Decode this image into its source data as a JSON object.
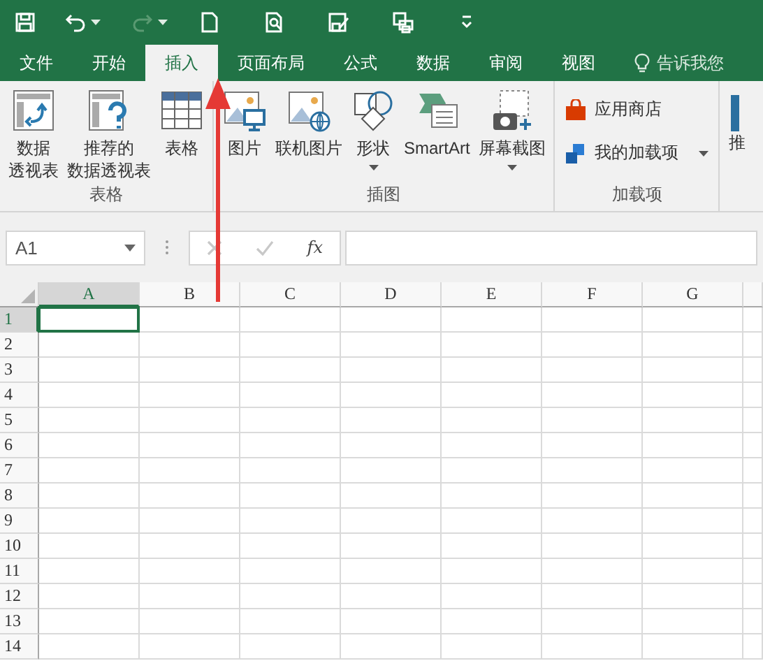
{
  "quick_access": [
    {
      "kind": "save",
      "disabled": false
    },
    {
      "kind": "undo",
      "disabled": false,
      "dropdown": true
    },
    {
      "kind": "redo",
      "disabled": true,
      "dropdown": true
    },
    {
      "kind": "new",
      "disabled": false
    },
    {
      "kind": "preview",
      "disabled": false
    },
    {
      "kind": "save-edit",
      "disabled": false
    },
    {
      "kind": "print",
      "disabled": false
    },
    {
      "kind": "customize",
      "disabled": false
    }
  ],
  "tabs": [
    {
      "label": "文件",
      "selected": false
    },
    {
      "label": "开始",
      "selected": false
    },
    {
      "label": "插入",
      "selected": true
    },
    {
      "label": "页面布局",
      "selected": false
    },
    {
      "label": "公式",
      "selected": false
    },
    {
      "label": "数据",
      "selected": false
    },
    {
      "label": "审阅",
      "selected": false
    },
    {
      "label": "视图",
      "selected": false
    }
  ],
  "tell_me": {
    "placeholder": "告诉我您"
  },
  "ribbon": {
    "groups": [
      {
        "label": "表格",
        "buttons": [
          {
            "kind": "pivot",
            "lines": [
              "数据",
              "透视表"
            ]
          },
          {
            "kind": "recommended-pivot",
            "lines": [
              "推荐的",
              "数据透视表"
            ]
          },
          {
            "kind": "table",
            "lines": [
              "表格"
            ]
          }
        ]
      },
      {
        "label": "插图",
        "buttons": [
          {
            "kind": "picture",
            "lines": [
              "图片"
            ]
          },
          {
            "kind": "online-picture",
            "lines": [
              "联机图片"
            ]
          },
          {
            "kind": "shapes",
            "lines": [
              "形状"
            ],
            "dropdown": true
          },
          {
            "kind": "smartart",
            "lines": [
              "SmartArt"
            ]
          },
          {
            "kind": "screenshot",
            "lines": [
              "屏幕截图"
            ],
            "dropdown": true
          }
        ]
      },
      {
        "label": "加载项",
        "small_buttons": [
          {
            "kind": "store",
            "label": "应用商店"
          },
          {
            "kind": "my-addins",
            "label": "我的加载项",
            "dropdown": true
          }
        ]
      },
      {
        "partial_label": "推"
      }
    ]
  },
  "formula_bar": {
    "name_box": "A1",
    "function_label": "fx"
  },
  "sheet": {
    "columns": [
      {
        "label": "A",
        "selected": true
      },
      {
        "label": "B",
        "selected": false
      },
      {
        "label": "C",
        "selected": false
      },
      {
        "label": "D",
        "selected": false
      },
      {
        "label": "E",
        "selected": false
      },
      {
        "label": "F",
        "selected": false
      },
      {
        "label": "G",
        "selected": false
      }
    ],
    "rows": [
      {
        "label": "1",
        "selected": true
      },
      {
        "label": "2",
        "selected": false
      },
      {
        "label": "3",
        "selected": false
      },
      {
        "label": "4",
        "selected": false
      },
      {
        "label": "5",
        "selected": false
      },
      {
        "label": "6",
        "selected": false
      },
      {
        "label": "7",
        "selected": false
      },
      {
        "label": "8",
        "selected": false
      },
      {
        "label": "9",
        "selected": false
      },
      {
        "label": "10",
        "selected": false
      },
      {
        "label": "11",
        "selected": false
      },
      {
        "label": "12",
        "selected": false
      },
      {
        "label": "13",
        "selected": false
      },
      {
        "label": "14",
        "selected": false
      }
    ]
  },
  "annotation_arrow": {
    "color": "#e53935"
  }
}
